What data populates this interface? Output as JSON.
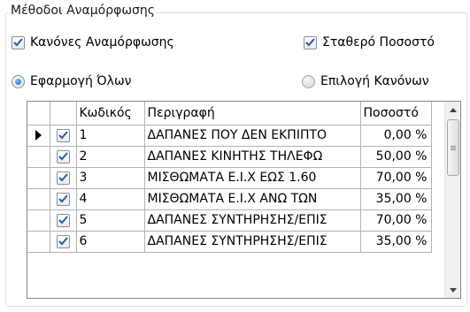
{
  "group": {
    "title": "Μέθοδοι Αναμόρφωσης"
  },
  "options": {
    "rules_checkbox": {
      "label": "Κανόνες Αναμόρφωσης",
      "checked": true
    },
    "fixed_checkbox": {
      "label": "Σταθερό Ποσοστό",
      "checked": true
    },
    "apply_all_radio": {
      "label": "Εφαρμογή Όλων",
      "selected": true
    },
    "select_rules_radio": {
      "label": "Επιλογή Κανόνων",
      "selected": false
    }
  },
  "grid": {
    "columns": {
      "code": "Κωδικός",
      "description": "Περιγραφή",
      "percent": "Ποσοστό"
    },
    "rows": [
      {
        "checked": true,
        "code": "1",
        "description": "ΔΑΠΑΝΕΣ ΠΟΥ ΔΕΝ ΕΚΠΙΠΤΟ",
        "percent": "0,00 %",
        "current": true
      },
      {
        "checked": true,
        "code": "2",
        "description": "ΔΑΠΑΝΕΣ ΚΙΝΗΤΗΣ ΤΗΛΕΦΩ",
        "percent": "50,00 %",
        "current": false
      },
      {
        "checked": true,
        "code": "3",
        "description": "ΜΙΣΘΩΜΑΤΑ Ε.Ι.Χ ΕΩΣ 1.60",
        "percent": "70,00 %",
        "current": false
      },
      {
        "checked": true,
        "code": "4",
        "description": "ΜΙΣΘΩΜΑΤΑ Ε.Ι.Χ ΑΝΩ ΤΩΝ",
        "percent": "35,00 %",
        "current": false
      },
      {
        "checked": true,
        "code": "5",
        "description": "ΔΑΠΑΝΕΣ ΣΥΝΤΗΡΗΣΗΣ/ΕΠΙΣ",
        "percent": "70,00 %",
        "current": false
      },
      {
        "checked": true,
        "code": "6",
        "description": "ΔΑΠΑΝΕΣ ΣΥΝΤΗΡΗΣΗΣ/ΕΠΙΣ",
        "percent": "35,00 %",
        "current": false
      }
    ]
  },
  "colors": {
    "check": "#2a5cae",
    "radio": "#1764c8",
    "grid_border": "#828790"
  }
}
